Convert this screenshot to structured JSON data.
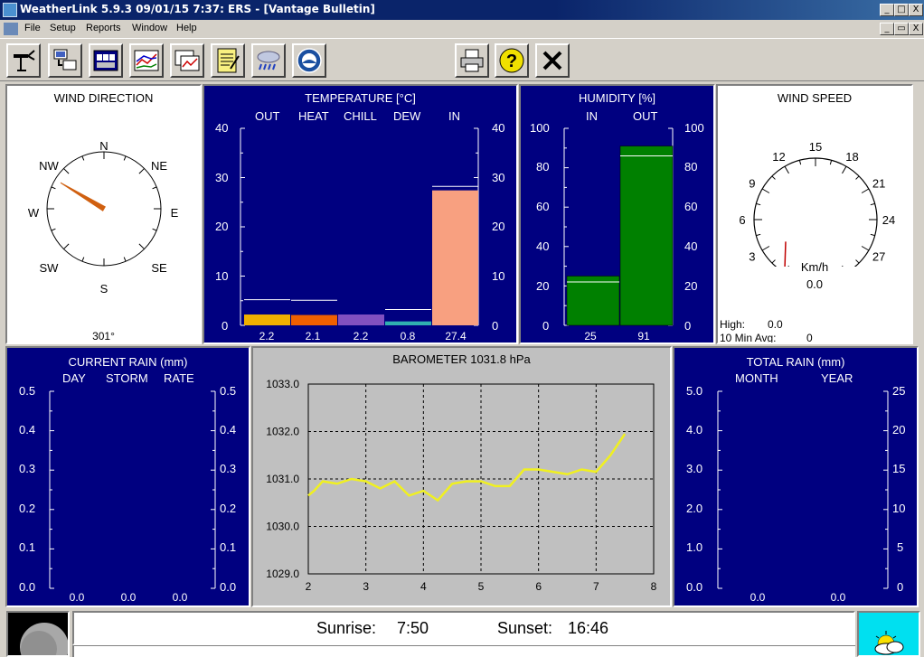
{
  "window": {
    "title": "WeatherLink 5.9.3  09/01/15  7:37: ERS - [Vantage Bulletin]",
    "minimize": "_",
    "maximize": "□",
    "close": "X",
    "child_minimize": "_",
    "child_restore": "▭",
    "child_close": "X"
  },
  "menu": [
    "File",
    "Setup",
    "Reports",
    "Window",
    "Help"
  ],
  "toolbar": {
    "icons": [
      "weather-station-icon",
      "download-icon",
      "bulletin-icon",
      "strip-chart-icon",
      "plot-icon",
      "notes-icon",
      "rain-forecast-icon",
      "noaa-icon",
      "print-icon",
      "help-icon",
      "exit-icon"
    ]
  },
  "wind_direction": {
    "title": "WIND DIRECTION",
    "labels": {
      "n": "N",
      "ne": "NE",
      "e": "E",
      "se": "SE",
      "s": "S",
      "sw": "SW",
      "w": "W",
      "nw": "NW"
    },
    "bearing_deg": 301,
    "readout": "301°",
    "needle_color": "#d06010"
  },
  "temperature": {
    "title": "TEMPERATURE  [°C]",
    "columns": [
      "OUT",
      "HEAT",
      "CHILL",
      "DEW",
      "IN"
    ],
    "ticks": [
      "40",
      "30",
      "20",
      "10",
      "0"
    ],
    "ticks_right": [
      "40",
      "30",
      "20",
      "10",
      "0"
    ],
    "values": [
      "2.2",
      "2.1",
      "2.2",
      "0.8",
      "27.4"
    ],
    "bar_values": [
      2.2,
      2.1,
      2.2,
      0.8,
      27.4
    ],
    "high_marks": [
      5.2,
      5.1,
      0,
      3.2,
      28.2
    ],
    "colors": [
      "#f0b000",
      "#f06000",
      "#8050c0",
      "#30b0b0",
      "#f8a080"
    ],
    "ylim": [
      0,
      40
    ]
  },
  "humidity": {
    "title": "HUMIDITY  [%]",
    "columns": [
      "IN",
      "OUT"
    ],
    "ticks": [
      "100",
      "80",
      "60",
      "40",
      "20",
      "0"
    ],
    "ticks_right": [
      "100",
      "80",
      "60",
      "40",
      "20",
      "0"
    ],
    "values": [
      "25",
      "91"
    ],
    "bar_values": [
      25,
      91
    ],
    "high_marks": [
      22,
      86
    ],
    "color": "#008000",
    "ylim": [
      0,
      100
    ]
  },
  "wind_speed": {
    "title": "WIND SPEED",
    "scale": [
      "0",
      "3",
      "6",
      "9",
      "12",
      "15",
      "18",
      "21",
      "24",
      "27",
      "30"
    ],
    "unit": "Km/h",
    "value": "0.0",
    "speed": 0,
    "high_label": "High:",
    "high_value": "0.0",
    "avg_label": "10 Min Avg:",
    "avg_value": "0"
  },
  "current_rain": {
    "title": "CURRENT RAIN  (mm)",
    "columns": [
      "DAY",
      "STORM",
      "RATE"
    ],
    "ticks": [
      "0.5",
      "0.4",
      "0.3",
      "0.2",
      "0.1",
      "0.0"
    ],
    "ticks_right": [
      "0.5",
      "0.4",
      "0.3",
      "0.2",
      "0.1",
      "0.0"
    ],
    "values": [
      "0.0",
      "0.0",
      "0.0"
    ]
  },
  "barometer": {
    "title": "BAROMETER 1031.8 hPa"
  },
  "total_rain": {
    "title": "TOTAL RAIN  (mm)",
    "columns": [
      "MONTH",
      "YEAR"
    ],
    "ticks_left": [
      "5.0",
      "4.0",
      "3.0",
      "2.0",
      "1.0",
      "0.0"
    ],
    "ticks_right": [
      "25",
      "20",
      "15",
      "10",
      "5",
      "0"
    ],
    "values": [
      "0.0",
      "0.0"
    ]
  },
  "sun": {
    "sunrise_label": "Sunrise:",
    "sunrise": "7:50",
    "sunset_label": "Sunset:",
    "sunset": "16:46"
  },
  "chart_data": {
    "type": "line",
    "title": "BAROMETER 1031.8 hPa",
    "xlabel": "",
    "ylabel": "",
    "xlim": [
      2,
      8
    ],
    "ylim": [
      1029.0,
      1033.0
    ],
    "x_ticks": [
      "2",
      "3",
      "4",
      "5",
      "6",
      "7",
      "8"
    ],
    "y_ticks": [
      "1033.0",
      "1032.0",
      "1031.0",
      "1030.0",
      "1029.0"
    ],
    "grid": true,
    "line_color": "#f0f020",
    "series": [
      {
        "x": [
          2.0,
          2.1,
          2.25,
          2.5,
          2.75,
          3.0,
          3.25,
          3.5,
          3.75,
          4.0,
          4.25,
          4.5,
          4.75,
          5.0,
          5.25,
          5.5,
          5.75,
          6.0,
          6.25,
          6.5,
          6.75,
          7.0,
          7.25,
          7.5
        ],
        "y": [
          1030.65,
          1030.75,
          1030.95,
          1030.9,
          1031.0,
          1030.95,
          1030.8,
          1030.95,
          1030.65,
          1030.75,
          1030.55,
          1030.9,
          1030.95,
          1030.95,
          1030.85,
          1030.85,
          1031.2,
          1031.2,
          1031.15,
          1031.1,
          1031.2,
          1031.15,
          1031.5,
          1031.95
        ]
      }
    ]
  }
}
